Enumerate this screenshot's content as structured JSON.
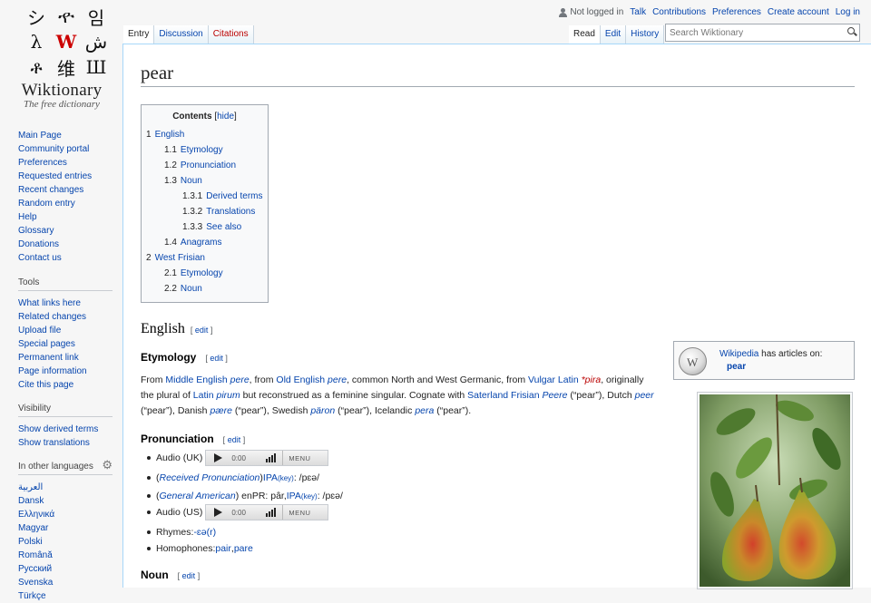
{
  "logo": {
    "glyphs": [
      "シ",
      "ዯ",
      "임",
      "λ",
      "W",
      "ش",
      "ቶ",
      "维",
      "Ш"
    ],
    "name": "Wiktionary",
    "tagline": "The free dictionary"
  },
  "sidebar": {
    "navigation": [
      "Main Page",
      "Community portal",
      "Preferences",
      "Requested entries",
      "Recent changes",
      "Random entry",
      "Help",
      "Glossary",
      "Donations",
      "Contact us"
    ],
    "tools_heading": "Tools",
    "tools": [
      "What links here",
      "Related changes",
      "Upload file",
      "Special pages",
      "Permanent link",
      "Page information",
      "Cite this page"
    ],
    "visibility_heading": "Visibility",
    "visibility": [
      "Show derived terms",
      "Show translations"
    ],
    "languages_heading": "In other languages",
    "languages": [
      "العربية",
      "Dansk",
      "Ελληνικά",
      "Magyar",
      "Polski",
      "Română",
      "Русский",
      "Svenska",
      "Türkçe"
    ]
  },
  "personal": {
    "not_logged_in": "Not logged in",
    "talk": "Talk",
    "contributions": "Contributions",
    "preferences": "Preferences",
    "create_account": "Create account",
    "log_in": "Log in"
  },
  "tabs": {
    "entry": "Entry",
    "discussion": "Discussion",
    "citations": "Citations",
    "read": "Read",
    "edit": "Edit",
    "history": "History"
  },
  "search": {
    "placeholder": "Search Wiktionary"
  },
  "page": {
    "title": "pear",
    "toc_title": "Contents",
    "toc_hide": "hide",
    "toc": [
      {
        "num": "1",
        "label": "English",
        "level": 1
      },
      {
        "num": "1.1",
        "label": "Etymology",
        "level": 2
      },
      {
        "num": "1.2",
        "label": "Pronunciation",
        "level": 2
      },
      {
        "num": "1.3",
        "label": "Noun",
        "level": 2
      },
      {
        "num": "1.3.1",
        "label": "Derived terms",
        "level": 3
      },
      {
        "num": "1.3.2",
        "label": "Translations",
        "level": 3
      },
      {
        "num": "1.3.3",
        "label": "See also",
        "level": 3
      },
      {
        "num": "1.4",
        "label": "Anagrams",
        "level": 2
      },
      {
        "num": "2",
        "label": "West Frisian",
        "level": 1
      },
      {
        "num": "2.1",
        "label": "Etymology",
        "level": 2
      },
      {
        "num": "2.2",
        "label": "Noun",
        "level": 2
      }
    ],
    "edit_label": "edit",
    "english_heading": "English",
    "etymology_heading": "Etymology",
    "etymology": {
      "from1": "From ",
      "middle_english": "Middle English",
      "pere1": "pere",
      "from2": ", from ",
      "old_english": "Old English",
      "pere2": "pere",
      "text3": ", common North and West Germanic, from ",
      "vulgar_latin": "Vulgar Latin",
      "pira": "*pira",
      "text4": ", originally",
      "text5": "the plural of ",
      "latin": "Latin",
      "pirum": "pirum",
      "text6": " but reconstrued as a feminine singular. Cognate with ",
      "saterland": "Saterland Frisian",
      "peere": "Peere",
      "text7": " (“pear”), Dutch ",
      "peer": "peer",
      "text8": "(“pear”), Danish ",
      "paere": "pære",
      "text9": " (“pear”), Swedish ",
      "paron": "päron",
      "text10": " (“pear”), Icelandic ",
      "pera": "pera",
      "text11": " (“pear”)."
    },
    "pronunciation_heading": "Pronunciation",
    "audio_uk": "Audio (UK)",
    "audio_us": "Audio (US)",
    "player_time": "0:00",
    "player_menu": "MENU",
    "rp_open": "(",
    "rp": "Received Pronunciation",
    "rp_close": ") ",
    "ipa": "IPA",
    "key": "(key)",
    "ipa_rp": ": /pɛə/",
    "ga": "General American",
    "enpr_label": ") enPR: pâr, ",
    "ipa_ga": ": /pɛə/",
    "rhymes_label": "Rhymes: ",
    "rhymes": "-ɛə(r)",
    "homophones_label": "Homophones: ",
    "homophone1": "pair",
    "homophone_sep": ", ",
    "homophone2": "pare",
    "noun_heading": "Noun",
    "wikipedia": {
      "link": "Wikipedia",
      "text": " has articles on:",
      "article": "pear"
    }
  }
}
